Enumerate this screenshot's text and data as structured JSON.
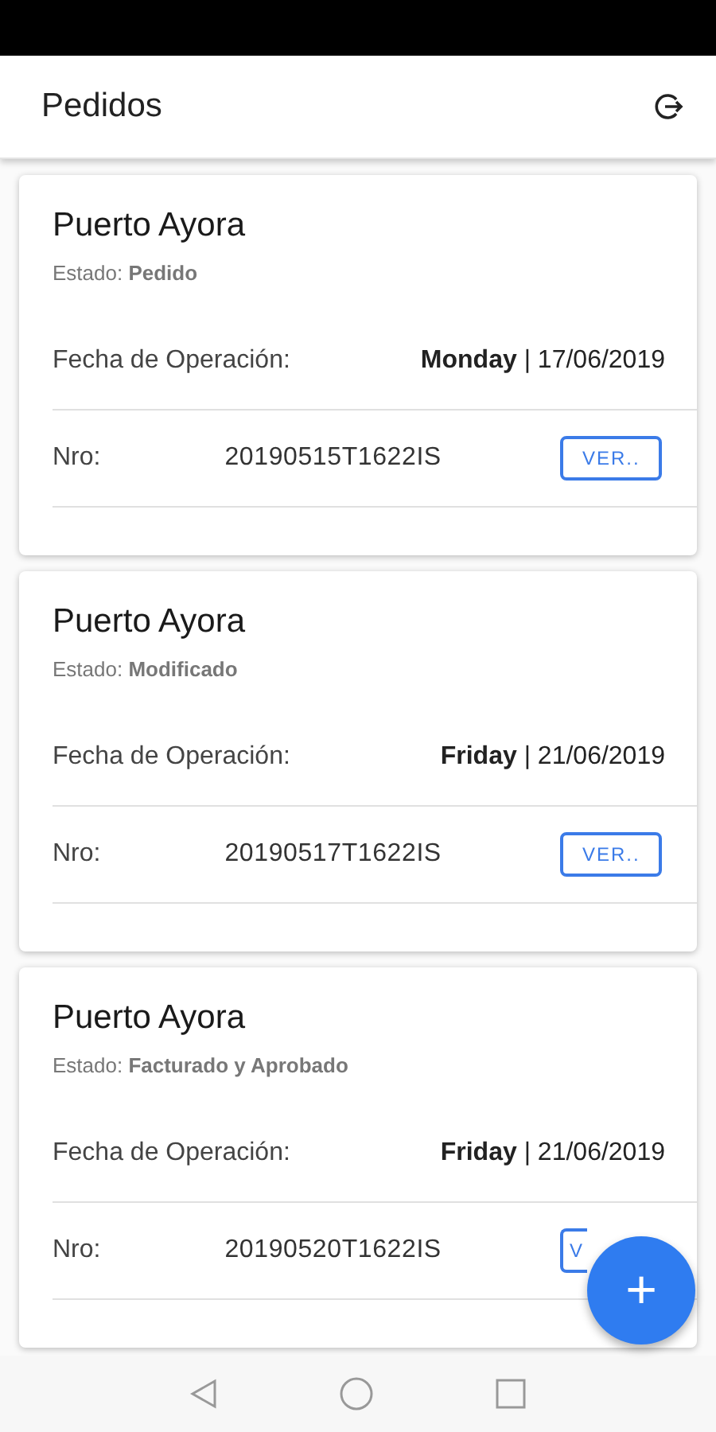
{
  "app_bar": {
    "title": "Pedidos"
  },
  "orders": [
    {
      "place": "Puerto Ayora",
      "status": "Estado: **Pedido**",
      "date_label": "Fecha de Operación:",
      "date": "**Monday** | 17/06/2019",
      "number_label": "Nro:",
      "number": "20190515T1622IS",
      "button": "VER..",
      "clipped": false
    },
    {
      "place": "Puerto Ayora",
      "status": "Estado: **Modificado**",
      "date_label": "Fecha de Operación:",
      "date": "**Friday** | 21/06/2019",
      "number_label": "Nro:",
      "number": "20190517T1622IS",
      "button": "VER..",
      "clipped": false
    },
    {
      "place": "Puerto Ayora",
      "status": "Estado: **Facturado y Aprobado**",
      "date_label": "Fecha de Operación:",
      "date": "**Friday** | 21/06/2019",
      "number_label": "Nro:",
      "number": "20190520T1622IS",
      "button": "V",
      "clipped": true
    }
  ],
  "fab": {
    "label": "+"
  }
}
